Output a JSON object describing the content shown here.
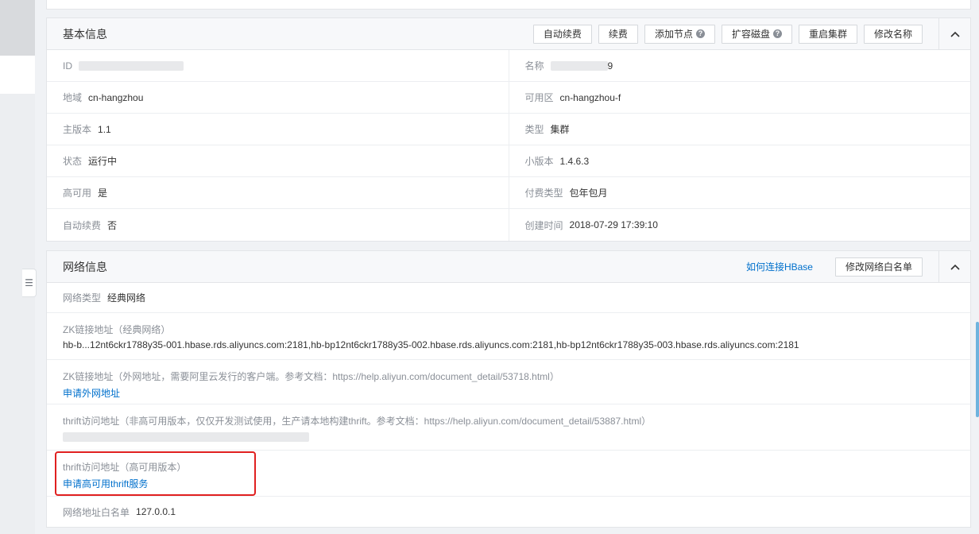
{
  "basic": {
    "title": "基本信息",
    "actions": {
      "auto_renew": "自动续费",
      "renew": "续费",
      "add_node": "添加节点",
      "expand_disk": "扩容磁盘",
      "restart": "重启集群",
      "rename": "修改名称"
    },
    "fields": {
      "id_label": "ID",
      "name_label": "名称",
      "name_value_tail": "9",
      "region_label": "地域",
      "region_value": "cn-hangzhou",
      "zone_label": "可用区",
      "zone_value": "cn-hangzhou-f",
      "major_label": "主版本",
      "major_value": "1.1",
      "type_label": "类型",
      "type_value": "集群",
      "status_label": "状态",
      "status_value": "运行中",
      "minor_label": "小版本",
      "minor_value": "1.4.6.3",
      "ha_label": "高可用",
      "ha_value": "是",
      "pay_label": "付费类型",
      "pay_value": "包年包月",
      "autorenew_label": "自动续费",
      "autorenew_value": "否",
      "created_label": "创建时间",
      "created_value": "2018-07-29 17:39:10"
    }
  },
  "network": {
    "title": "网络信息",
    "help_link": "如何连接HBase",
    "edit_whitelist": "修改网络白名单",
    "net_type_label": "网络类型",
    "net_type_value": "经典网络",
    "zk_classic_label": "ZK链接地址（经典网络）",
    "zk_classic_value": "hb-b...12nt6ckr1788y35-001.hbase.rds.aliyuncs.com:2181,hb-bp12nt6ckr1788y35-002.hbase.rds.aliyuncs.com:2181,hb-bp12nt6ckr1788y35-003.hbase.rds.aliyuncs.com:2181",
    "zk_public_label": "ZK链接地址（外网地址，需要阿里云发行的客户端。参考文档：https://help.aliyun.com/document_detail/53718.html）",
    "zk_public_link": "申请外网地址",
    "thrift_label": "thrift访问地址（非高可用版本，仅仅开发测试使用，生产请本地构建thrift。参考文档：https://help.aliyun.com/document_detail/53887.html）",
    "thrift_value": "",
    "thrift_ha_label": "thrift访问地址（高可用版本）",
    "thrift_ha_link": "申请高可用thrift服务",
    "whitelist_label": "网络地址白名单",
    "whitelist_value": "127.0.0.1"
  },
  "icons": {
    "chevron": "chevron-up-icon",
    "question": "question-icon",
    "sidebar_toggle": "sidebar-toggle-icon"
  },
  "colors": {
    "link": "#0070cc",
    "highlight": "#e02020"
  }
}
